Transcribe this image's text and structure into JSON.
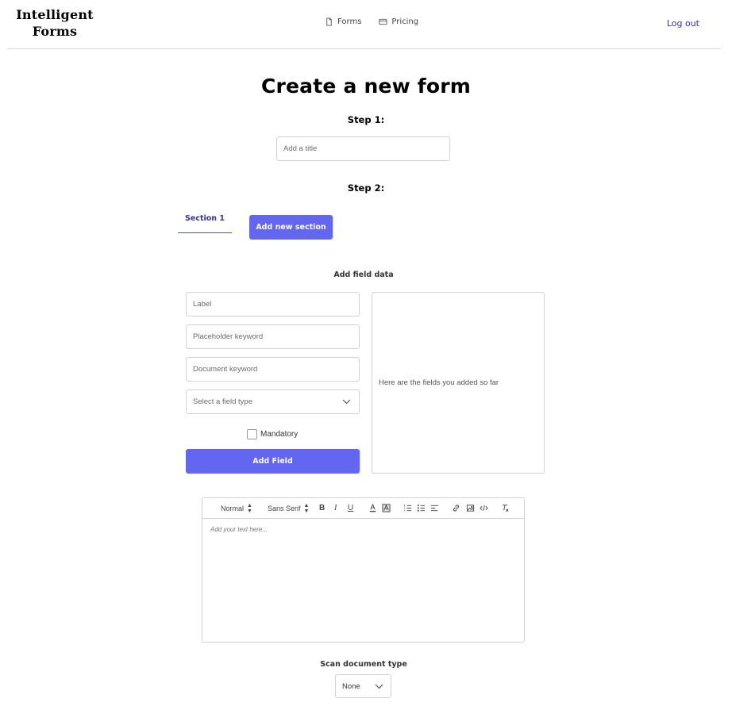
{
  "header": {
    "logo_line1": "Intelligent",
    "logo_line2": "Forms",
    "nav": [
      {
        "label": "Forms",
        "icon": "file-icon"
      },
      {
        "label": "Pricing",
        "icon": "credit-card-icon"
      }
    ],
    "logout_label": "Log out"
  },
  "page": {
    "title": "Create a new form",
    "step1_label": "Step 1:",
    "title_placeholder": "Add a title",
    "step2_label": "Step 2:"
  },
  "sections": {
    "tabs": [
      {
        "label": "Section 1",
        "active": true
      }
    ],
    "add_section_label": "Add new section"
  },
  "field_form": {
    "heading": "Add field data",
    "label_placeholder": "Label",
    "placeholder_keyword_placeholder": "Placeholder keyword",
    "document_keyword_placeholder": "Document keyword",
    "field_type_value": "Select a field type",
    "mandatory_label": "Mandatory",
    "mandatory_checked": false,
    "add_field_label": "Add Field",
    "fields_empty_text": "Here are the fields you added so far"
  },
  "editor": {
    "header_picker": "Normal",
    "font_picker": "Sans Serif",
    "placeholder": "Add your text here..."
  },
  "scan": {
    "heading": "Scan document type",
    "value": "None"
  },
  "colors": {
    "accent": "#6366f1",
    "link": "#3730a3",
    "border": "#cfd2d6"
  }
}
